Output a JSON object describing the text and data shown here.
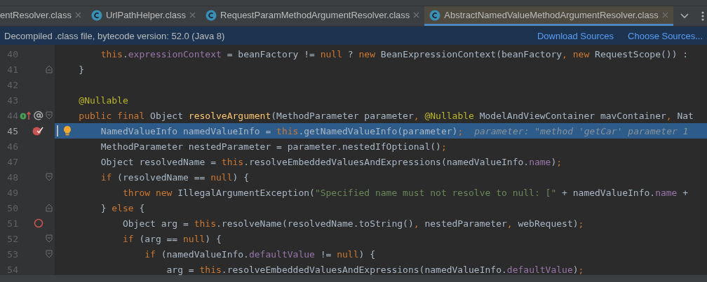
{
  "tabs": [
    {
      "label": "entResolver.class",
      "selected": false
    },
    {
      "label": "UrlPathHelper.class",
      "selected": false
    },
    {
      "label": "RequestParamMethodArgumentResolver.class",
      "selected": false
    },
    {
      "label": "AbstractNamedValueMethodArgumentResolver.class",
      "selected": true
    }
  ],
  "banner": {
    "message": "Decompiled .class file, bytecode version: 52.0 (Java 8)",
    "links": [
      "Download Sources",
      "Choose Sources..."
    ]
  },
  "lines": [
    {
      "number": "40",
      "segments": [
        {
          "kind": "keyword",
          "text": "        this"
        },
        {
          "kind": "plain",
          "text": "."
        },
        {
          "kind": "field",
          "text": "expressionContext"
        },
        {
          "kind": "plain",
          "text": " = beanFactory != "
        },
        {
          "kind": "keyword",
          "text": "null"
        },
        {
          "kind": "plain",
          "text": " ? "
        },
        {
          "kind": "keyword",
          "text": "new"
        },
        {
          "kind": "plain",
          "text": " BeanExpressionContext(beanFactory"
        },
        {
          "kind": "keyword",
          "text": ", new"
        },
        {
          "kind": "plain",
          "text": " RequestScope()) :"
        }
      ]
    },
    {
      "number": "41",
      "fold_end": true,
      "segments": [
        {
          "kind": "plain",
          "text": "    }"
        }
      ]
    },
    {
      "number": "42"
    },
    {
      "number": "43",
      "segments": [
        {
          "kind": "annotation",
          "text": "    @Nullable"
        }
      ]
    },
    {
      "number": "44",
      "fold_start": true,
      "implements_marker": true,
      "segments": [
        {
          "kind": "keyword",
          "text": "    public final "
        },
        {
          "kind": "plain",
          "text": "Object "
        },
        {
          "kind": "method",
          "text": "resolveArgument"
        },
        {
          "kind": "plain",
          "text": "(MethodParameter parameter"
        },
        {
          "kind": "keyword",
          "text": ", "
        },
        {
          "kind": "annotation",
          "text": "@Nullable"
        },
        {
          "kind": "plain",
          "text": " ModelAndViewContainer mavContainer"
        },
        {
          "kind": "keyword",
          "text": ", "
        },
        {
          "kind": "plain",
          "text": "Nat"
        }
      ]
    },
    {
      "number": "45",
      "current": true,
      "breakpoint": true,
      "stopped": true,
      "hint": "parameter: \"method 'getCar' parameter 1",
      "segments": [
        {
          "kind": "plain",
          "text": "        NamedValueInfo namedValueInfo = "
        },
        {
          "kind": "keyword",
          "text": "this"
        },
        {
          "kind": "plain",
          "text": ".getNamedValueInfo(parameter)"
        },
        {
          "kind": "keyword",
          "text": ";"
        }
      ]
    },
    {
      "number": "46",
      "segments": [
        {
          "kind": "plain",
          "text": "        MethodParameter nestedParameter = parameter.nestedIfOptional()"
        },
        {
          "kind": "keyword",
          "text": ";"
        }
      ]
    },
    {
      "number": "47",
      "segments": [
        {
          "kind": "plain",
          "text": "        Object resolvedName = "
        },
        {
          "kind": "keyword",
          "text": "this"
        },
        {
          "kind": "plain",
          "text": ".resolveEmbeddedValuesAndExpressions(namedValueInfo."
        },
        {
          "kind": "field",
          "text": "name"
        },
        {
          "kind": "plain",
          "text": ")"
        },
        {
          "kind": "keyword",
          "text": ";"
        }
      ]
    },
    {
      "number": "48",
      "fold_start": true,
      "segments": [
        {
          "kind": "keyword",
          "text": "        if "
        },
        {
          "kind": "plain",
          "text": "(resolvedName == "
        },
        {
          "kind": "keyword",
          "text": "null"
        },
        {
          "kind": "plain",
          "text": ") {"
        }
      ]
    },
    {
      "number": "49",
      "segments": [
        {
          "kind": "keyword",
          "text": "            throw new "
        },
        {
          "kind": "plain",
          "text": "IllegalArgumentException("
        },
        {
          "kind": "string",
          "text": "\"Specified name must not resolve to null: [\""
        },
        {
          "kind": "plain",
          "text": " + namedValueInfo."
        },
        {
          "kind": "field",
          "text": "name"
        },
        {
          "kind": "plain",
          "text": " +"
        }
      ]
    },
    {
      "number": "50",
      "fold_end": true,
      "segments": [
        {
          "kind": "plain",
          "text": "        } "
        },
        {
          "kind": "keyword",
          "text": "else "
        },
        {
          "kind": "plain",
          "text": "{"
        }
      ]
    },
    {
      "number": "51",
      "breakpoint": true,
      "stopped": false,
      "segments": [
        {
          "kind": "plain",
          "text": "            Object arg = "
        },
        {
          "kind": "keyword",
          "text": "this"
        },
        {
          "kind": "plain",
          "text": ".resolveName(resolvedName.toString()"
        },
        {
          "kind": "keyword",
          "text": ", "
        },
        {
          "kind": "plain",
          "text": "nestedParameter"
        },
        {
          "kind": "keyword",
          "text": ", "
        },
        {
          "kind": "plain",
          "text": "webRequest)"
        },
        {
          "kind": "keyword",
          "text": ";"
        }
      ]
    },
    {
      "number": "52",
      "fold_start": true,
      "segments": [
        {
          "kind": "keyword",
          "text": "            if "
        },
        {
          "kind": "plain",
          "text": "(arg == "
        },
        {
          "kind": "keyword",
          "text": "null"
        },
        {
          "kind": "plain",
          "text": ") {"
        }
      ]
    },
    {
      "number": "53",
      "fold_start": true,
      "segments": [
        {
          "kind": "keyword",
          "text": "                if "
        },
        {
          "kind": "plain",
          "text": "(namedValueInfo."
        },
        {
          "kind": "field",
          "text": "defaultValue"
        },
        {
          "kind": "plain",
          "text": " != "
        },
        {
          "kind": "keyword",
          "text": "null"
        },
        {
          "kind": "plain",
          "text": ") {"
        }
      ]
    },
    {
      "number": "54",
      "segments": [
        {
          "kind": "plain",
          "text": "                    arg = "
        },
        {
          "kind": "keyword",
          "text": "this"
        },
        {
          "kind": "plain",
          "text": ".resolveEmbeddedValuesAndExpressions(namedValueInfo."
        },
        {
          "kind": "field",
          "text": "defaultValue"
        },
        {
          "kind": "plain",
          "text": ")"
        },
        {
          "kind": "keyword",
          "text": ";"
        }
      ]
    }
  ]
}
